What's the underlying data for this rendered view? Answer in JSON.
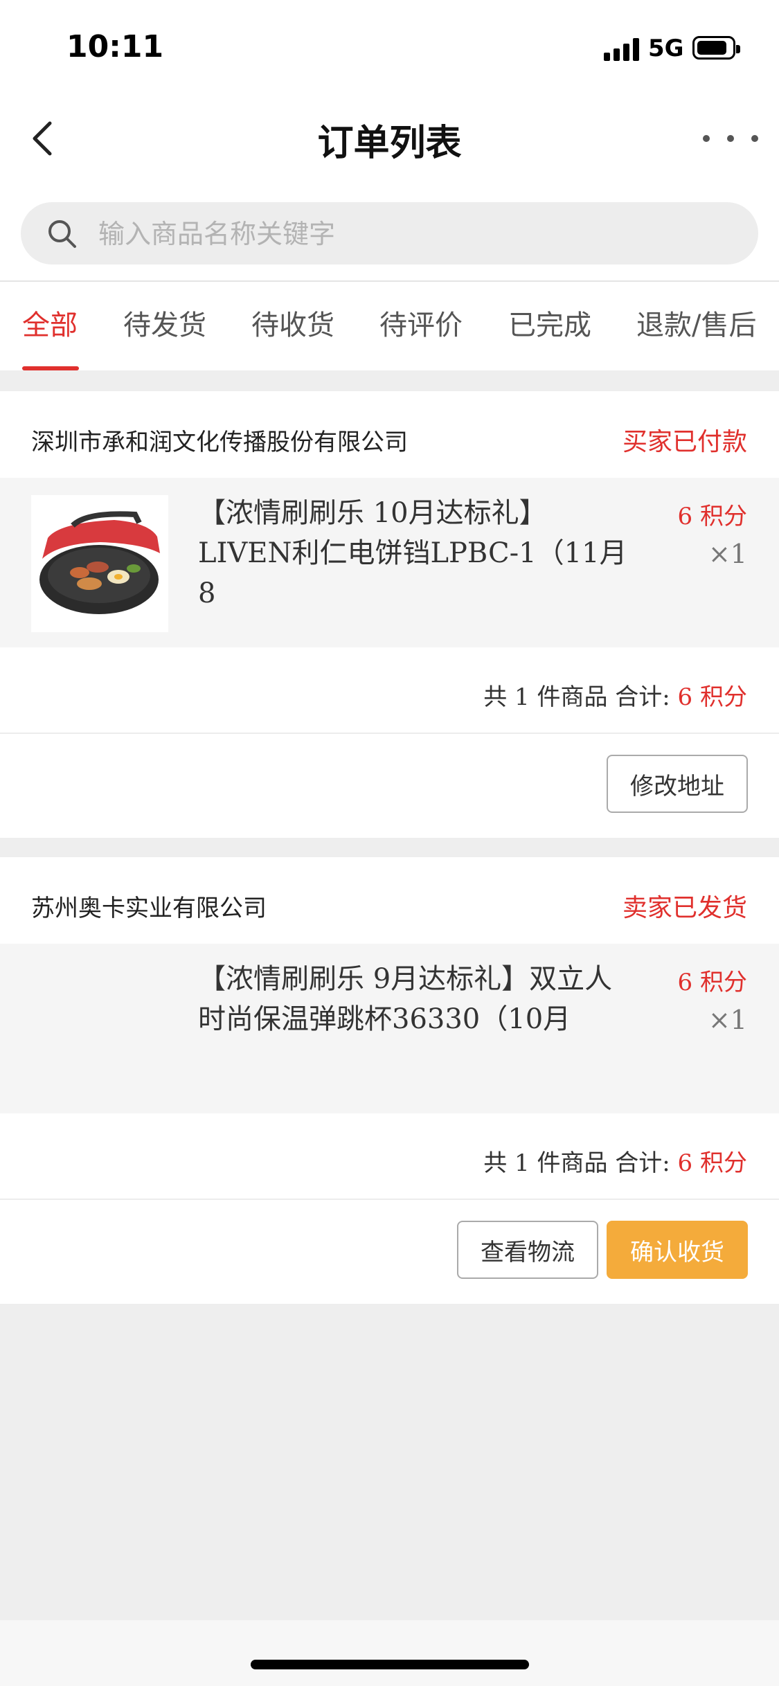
{
  "status_bar": {
    "time": "10:11",
    "network": "5G"
  },
  "header": {
    "title": "订单列表"
  },
  "search": {
    "placeholder": "输入商品名称关键字",
    "value": ""
  },
  "tabs": [
    {
      "label": "全部",
      "active": true
    },
    {
      "label": "待发货"
    },
    {
      "label": "待收货"
    },
    {
      "label": "待评价"
    },
    {
      "label": "已完成"
    },
    {
      "label": "退款/售后"
    }
  ],
  "orders": [
    {
      "company": "深圳市承和润文化传播股份有限公司",
      "status": "买家已付款",
      "item_name": "【浓情刷刷乐 10月达标礼】LIVEN利仁电饼铛LPBC-1（11月8",
      "price": "6 积分",
      "qty": "×1",
      "summary_prefix": "共 1 件商品 合计: ",
      "summary_total": "6 积分",
      "buttons": [
        "修改地址"
      ]
    },
    {
      "company": "苏州奥卡实业有限公司",
      "status": "卖家已发货",
      "item_name": "【浓情刷刷乐 9月达标礼】双立人 时尚保温弹跳杯36330（10月",
      "price": "6 积分",
      "qty": "×1",
      "summary_prefix": "共 1 件商品 合计: ",
      "summary_total": "6 积分",
      "buttons": [
        "查看物流",
        "确认收货"
      ]
    }
  ],
  "colors": {
    "accent": "#e0302d",
    "confirm": "#f4ab3b"
  }
}
